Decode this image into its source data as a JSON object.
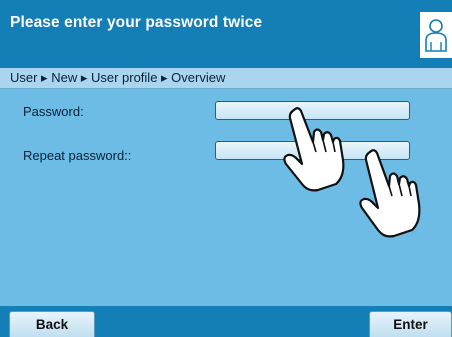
{
  "header": {
    "title": "Please enter your password twice",
    "user_icon": "user-icon"
  },
  "breadcrumb": "User ▸ New ▸ User profile ▸ Overview",
  "form": {
    "password_label": "Password:",
    "password_value": "",
    "repeat_label": "Repeat password::",
    "repeat_value": ""
  },
  "footer": {
    "back_label": "Back",
    "enter_label": "Enter"
  },
  "colors": {
    "header_blue": "#147fb6",
    "content_blue": "#6cbce6",
    "breadcrumb_blue": "#a9d5ee"
  },
  "icons": [
    "user-icon",
    "pointing-hand-icon"
  ]
}
